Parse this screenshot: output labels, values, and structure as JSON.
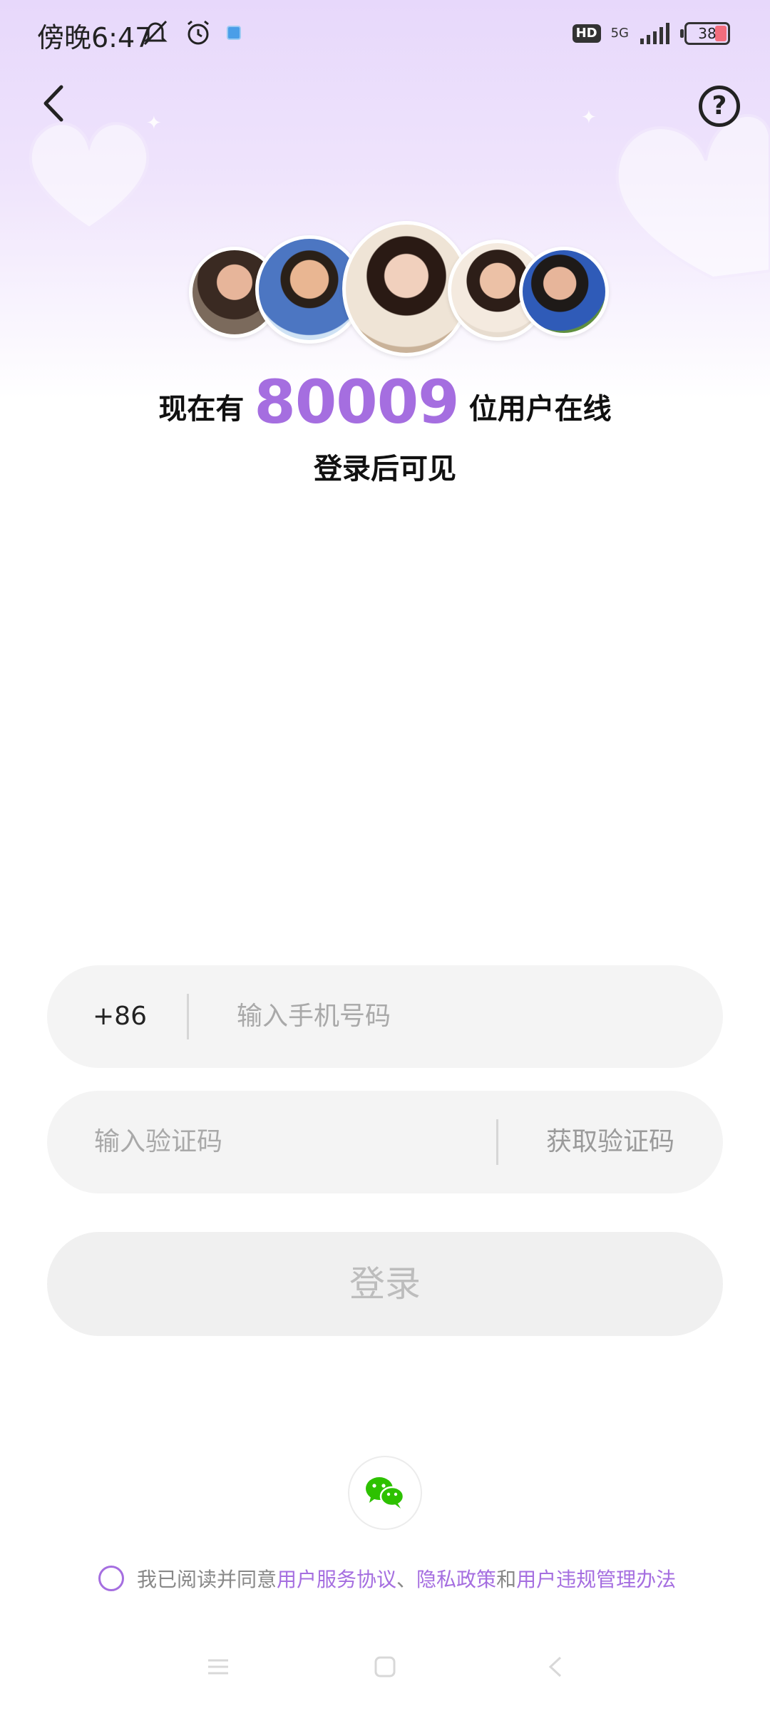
{
  "status_bar": {
    "time": "傍晚6:47",
    "hd": "HD",
    "network": "5G",
    "battery": "38"
  },
  "header": {
    "help_label": "?"
  },
  "hero": {
    "prefix": "现在有",
    "online_count": "80009",
    "suffix": "位用户在线",
    "subtitle": "登录后可见"
  },
  "form": {
    "country_code": "+86",
    "phone_placeholder": "输入手机号码",
    "code_placeholder": "输入验证码",
    "get_code_label": "获取验证码",
    "login_label": "登录"
  },
  "agreement": {
    "prefix": "我已阅读并同意",
    "link1": "用户服务协议",
    "sep1": "、",
    "link2": "隐私政策",
    "sep2": "和",
    "link3": "用户违规管理办法"
  },
  "colors": {
    "accent": "#a56ee0",
    "wechat": "#2dc100"
  }
}
